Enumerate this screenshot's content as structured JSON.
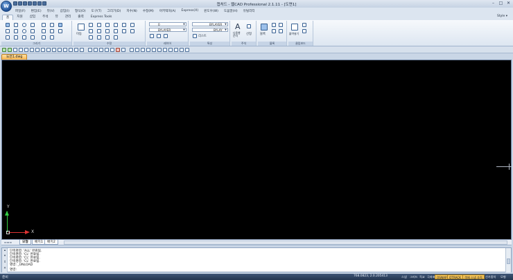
{
  "window": {
    "title": "캡처드 - 웹CAD Professional 2.1.11 - [도면1]",
    "controls": [
      "minimize",
      "maximize",
      "close"
    ]
  },
  "app_logo_text": "W",
  "menubar": {
    "items": [
      "파일(F)",
      "편집(E)",
      "뷰(V)",
      "삽입(I)",
      "형식(O)",
      "도구(T)",
      "그리기(D)",
      "치수(N)",
      "수정(M)",
      "아키텍처(A)",
      "Express(X)",
      "윈도우(W)",
      "도움말(H)",
      "유틸리티"
    ]
  },
  "ribbon_tabs": {
    "items": [
      "홈",
      "지원",
      "삽입",
      "주석",
      "뷰",
      "관리",
      "출력",
      "Express Tools"
    ],
    "active_index": 0,
    "style_label": "Style ▾"
  },
  "ribbon": {
    "panels": [
      {
        "label": "그리기"
      },
      {
        "label": "수정"
      },
      {
        "label": "레이어"
      },
      {
        "label": "특성"
      },
      {
        "label": "주석"
      },
      {
        "label": "블록"
      },
      {
        "label": "클립보드"
      }
    ],
    "layer_combo": "0",
    "color_combo": "BYLAYER",
    "linetype_combo": "BYLAYER",
    "lineweight_combo": "BYLAY",
    "plot_style_label": "리스트",
    "text_label": "다중행\n문자",
    "dim_label": "선형",
    "insert_label": "블록",
    "paste_label": "붙여넣기",
    "move_label": "이동"
  },
  "document_tab": "도면1.dwg",
  "layout_tabs": [
    "모형",
    "배치1",
    "배치2"
  ],
  "command_window": {
    "lines": [
      "단축명령: 'ALL' 완료됨.",
      "단축명령: 'CL' 완료됨.",
      "단축명령: 'CL' 완료됨.",
      "단축명령: 'CL' 완료됨.",
      "명령: _UNLOAD",
      "명령:"
    ],
    "side_buttons": [
      "▴",
      "▾",
      "⇕",
      "✕"
    ]
  },
  "status_bar": {
    "message": "준비",
    "coords": "768.0823, 2.0.205413",
    "buttons": [
      {
        "label": "스냅",
        "on": false
      },
      {
        "label": "그리드",
        "on": false
      },
      {
        "label": "직교",
        "on": false
      },
      {
        "label": "극좌표",
        "on": false
      },
      {
        "label": "OSNAP",
        "on": true
      },
      {
        "label": "OTRACK",
        "on": true
      },
      {
        "label": "객체 스냅 추적",
        "on": true
      },
      {
        "label": "선가중치",
        "on": false
      },
      {
        "label": "모형",
        "on": false
      }
    ]
  },
  "colors": {
    "canvas": "#000000",
    "ucs_x": "#dd3333",
    "ucs_y": "#33cc44",
    "active_doc_tab": "#f7b14a",
    "status_on": "#f2c257"
  }
}
